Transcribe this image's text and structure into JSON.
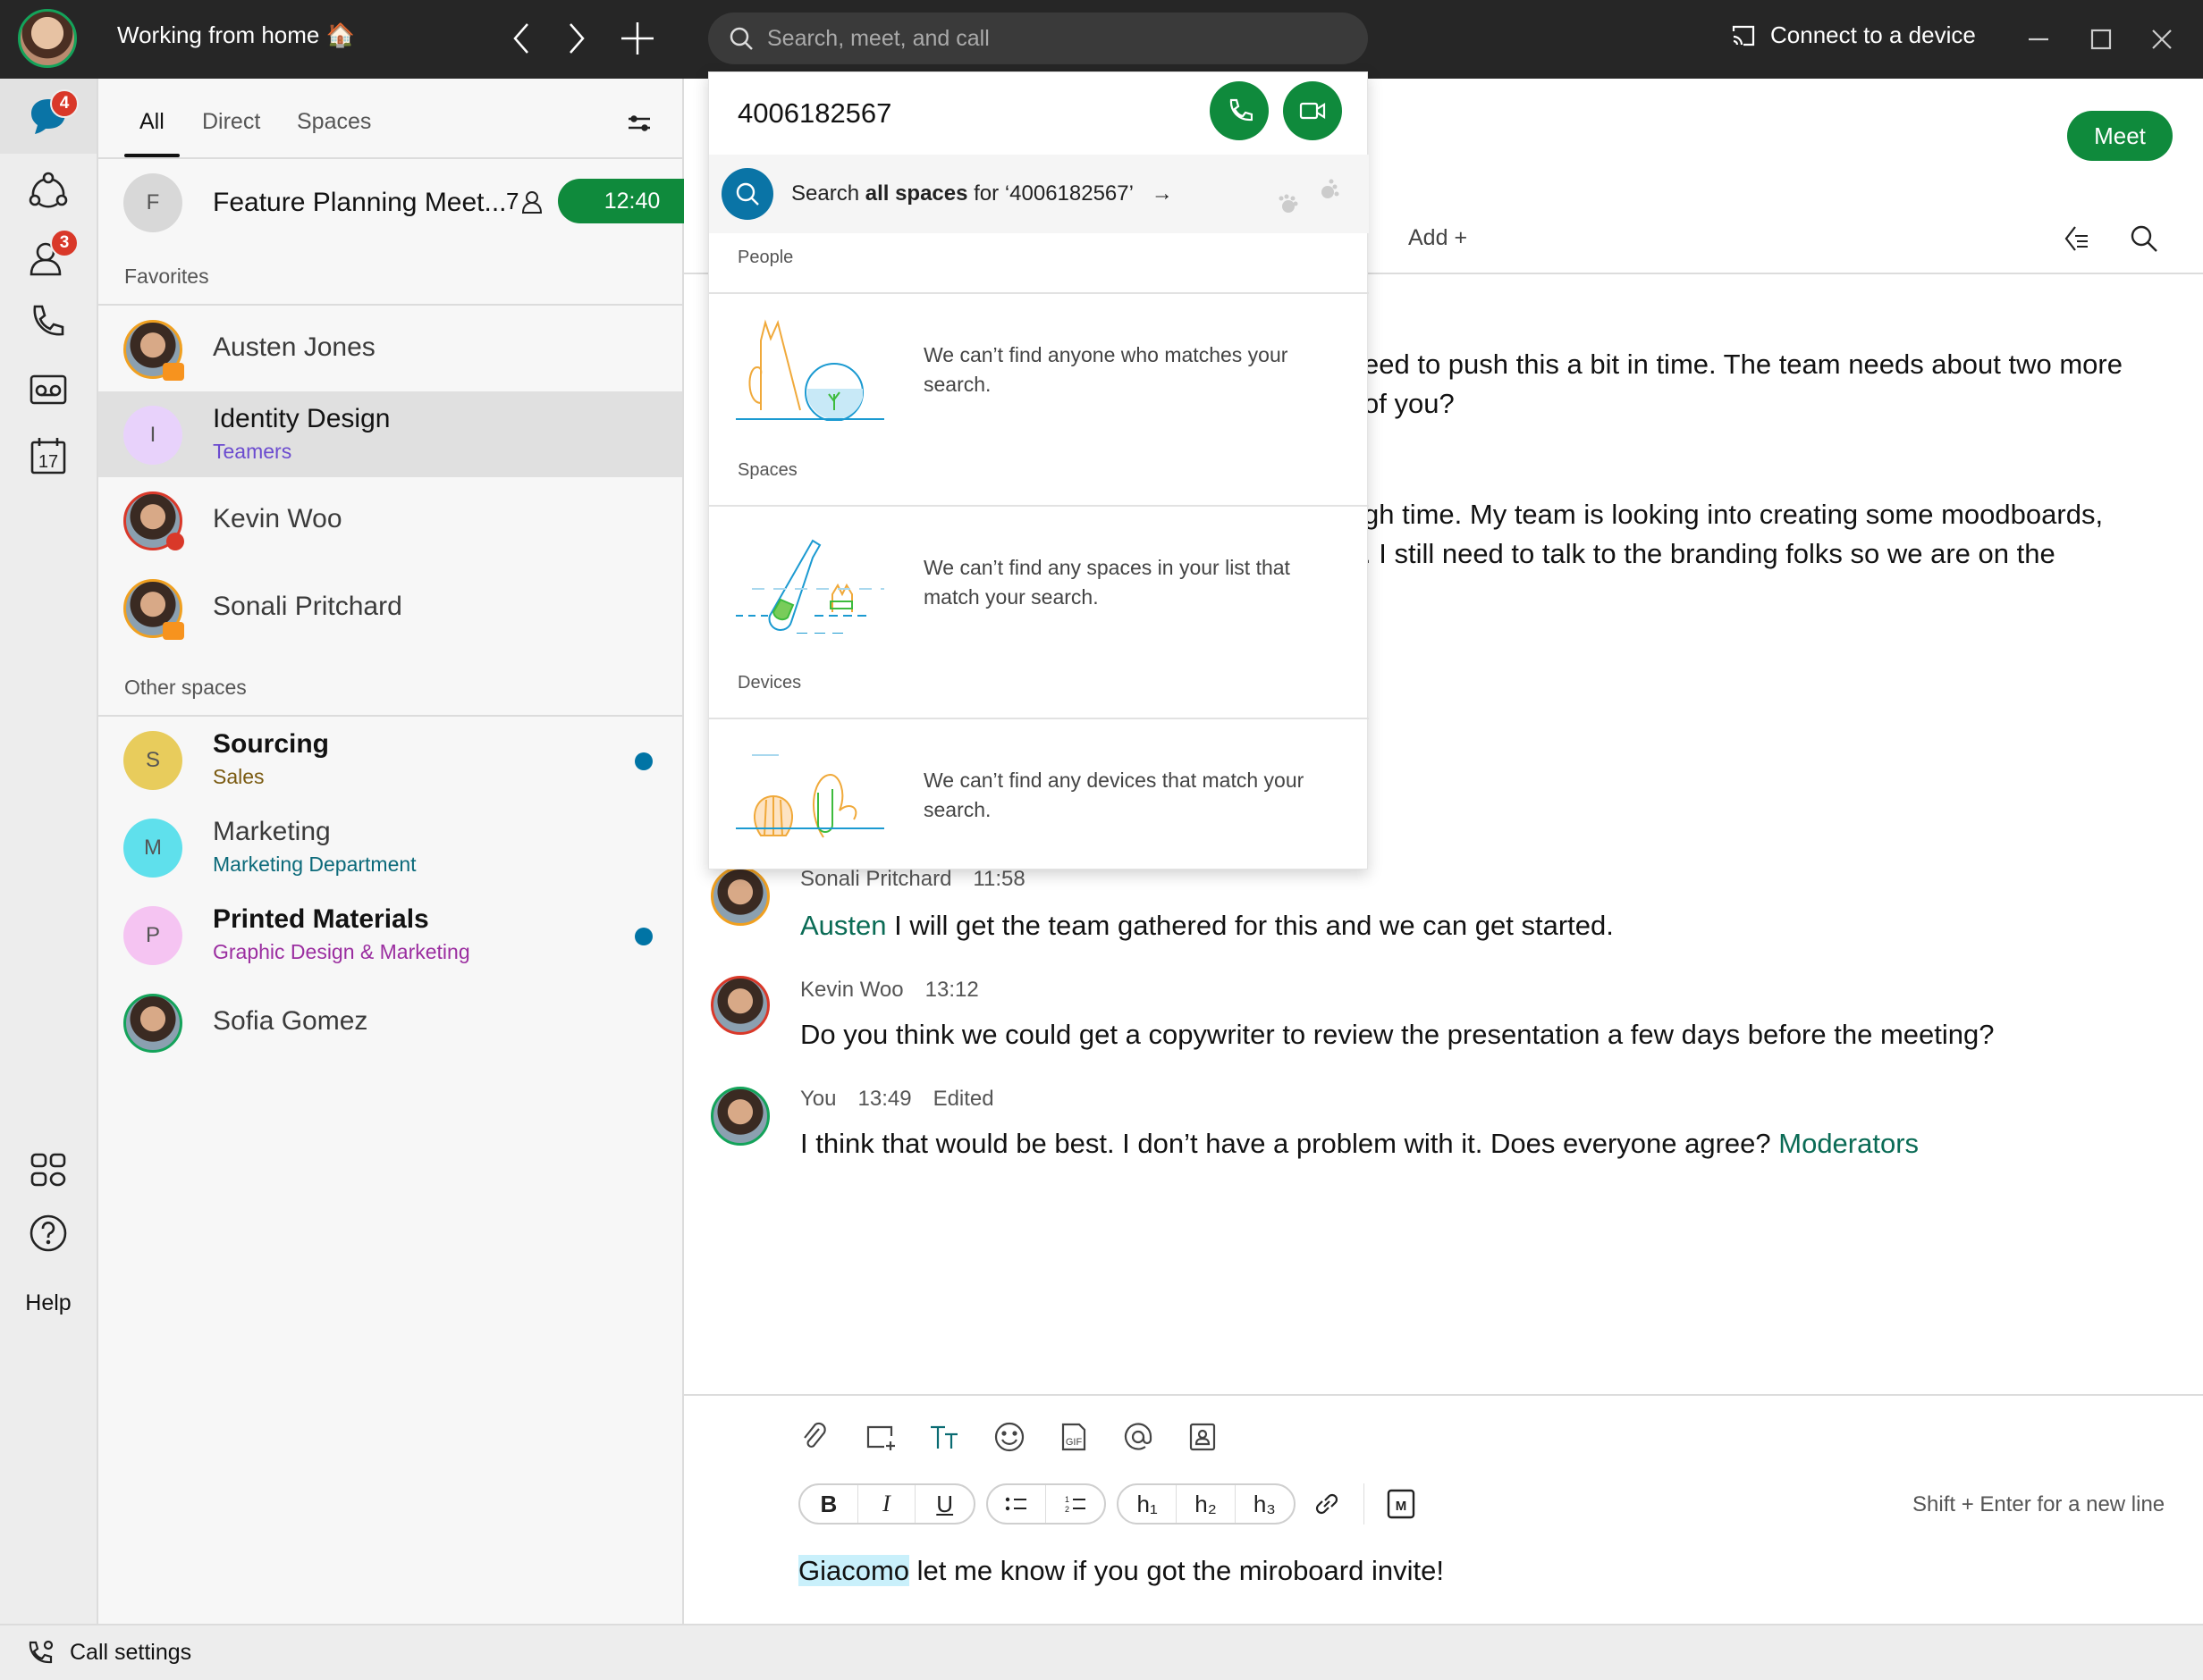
{
  "titlebar": {
    "status": "Working from home 🏠",
    "search_placeholder": "Search, meet, and call",
    "connect_label": "Connect to a device",
    "icons": [
      "back-icon",
      "forward-icon",
      "add-icon",
      "search-icon",
      "cast-icon",
      "minimize-icon",
      "maximize-icon",
      "close-icon"
    ]
  },
  "rail": {
    "items": [
      {
        "name": "messaging",
        "icon": "chat-icon",
        "badge": "4"
      },
      {
        "name": "teams",
        "icon": "teams-icon"
      },
      {
        "name": "contacts",
        "icon": "contacts-icon",
        "badge": "3"
      },
      {
        "name": "calling",
        "icon": "phone-icon"
      },
      {
        "name": "voicemail",
        "icon": "voicemail-icon"
      },
      {
        "name": "calendar",
        "icon": "calendar-icon",
        "label": "17"
      },
      {
        "name": "apps",
        "icon": "apps-icon"
      },
      {
        "name": "help",
        "icon": "help-icon",
        "label": "Help"
      }
    ]
  },
  "list": {
    "tabs": [
      {
        "label": "All",
        "active": true
      },
      {
        "label": "Direct"
      },
      {
        "label": "Spaces"
      }
    ],
    "meeting": {
      "initial": "F",
      "name": "Feature Planning Meet...",
      "participants": "7",
      "time": "12:40"
    },
    "favorites_label": "Favorites",
    "favorites": [
      {
        "name": "Austen Jones",
        "presence": "video"
      },
      {
        "initial": "I",
        "name": "Identity Design",
        "sub": "Teamers",
        "selected": true
      },
      {
        "name": "Kevin Woo",
        "presence": "dnd"
      },
      {
        "name": "Sonali Pritchard",
        "presence": "video"
      }
    ],
    "other_label": "Other spaces",
    "others": [
      {
        "initial": "S",
        "name": "Sourcing",
        "sub": "Sales",
        "unread": true
      },
      {
        "initial": "M",
        "name": "Marketing",
        "sub": "Marketing Department"
      },
      {
        "initial": "P",
        "name": "Printed Materials",
        "sub": "Graphic Design & Marketing",
        "unread": true
      },
      {
        "name": "Sofia Gomez",
        "presence": "active"
      }
    ]
  },
  "main": {
    "meet_label": "Meet",
    "add_label": "Add",
    "partial_messages": [
      "eed to push this a bit in time. The team needs about two more",
      "of you?",
      "gh time. My team is looking into creating some moodboards,",
      ". I still need to talk to the branding folks so we are on the"
    ],
    "messages": [
      {
        "author": "Sonali Pritchard",
        "time": "11:58",
        "mention": "Austen",
        "text": " I will get the team gathered for this and we can get started."
      },
      {
        "author": "Kevin Woo",
        "time": "13:12",
        "text": "Do you think we could get a copywriter to review the presentation a few days before the meeting?"
      },
      {
        "author": "You",
        "time": "13:49",
        "edited": "Edited",
        "text": "I think that would be best. I don’t have a problem with it. Does everyone agree?  ",
        "mention_after": "Moderators"
      }
    ],
    "composer": {
      "toolbar_icons": [
        "attach-icon",
        "screenshot-icon",
        "text-format-icon",
        "emoji-icon",
        "gif-icon",
        "mention-icon",
        "contact-card-icon"
      ],
      "format": {
        "bold": "B",
        "italic": "I",
        "underline": "U",
        "h1": "h₁",
        "h2": "h₂",
        "h3": "h₃"
      },
      "hint": "Shift + Enter for a new line",
      "draft_mention": "Giacomo",
      "draft_text": " let me know if you got the miroboard invite!"
    }
  },
  "dropdown": {
    "query": "4006182567",
    "search_all_prefix": "Search ",
    "search_all_bold": "all spaces",
    "search_all_suffix": " for ‘4006182567’",
    "sections": [
      {
        "label": "People",
        "empty": "We can’t find anyone who matches your search."
      },
      {
        "label": "Spaces",
        "empty": "We can’t find any spaces in your list that match your search."
      },
      {
        "label": "Devices",
        "empty": "We can’t find any devices that match your search."
      }
    ]
  },
  "bottombar": {
    "call_settings": "Call settings"
  },
  "colors": {
    "accent_green": "#0f8a3c",
    "badge_red": "#d93829",
    "unread_blue": "#0074a5",
    "mention_teal": "#0a6b55"
  }
}
